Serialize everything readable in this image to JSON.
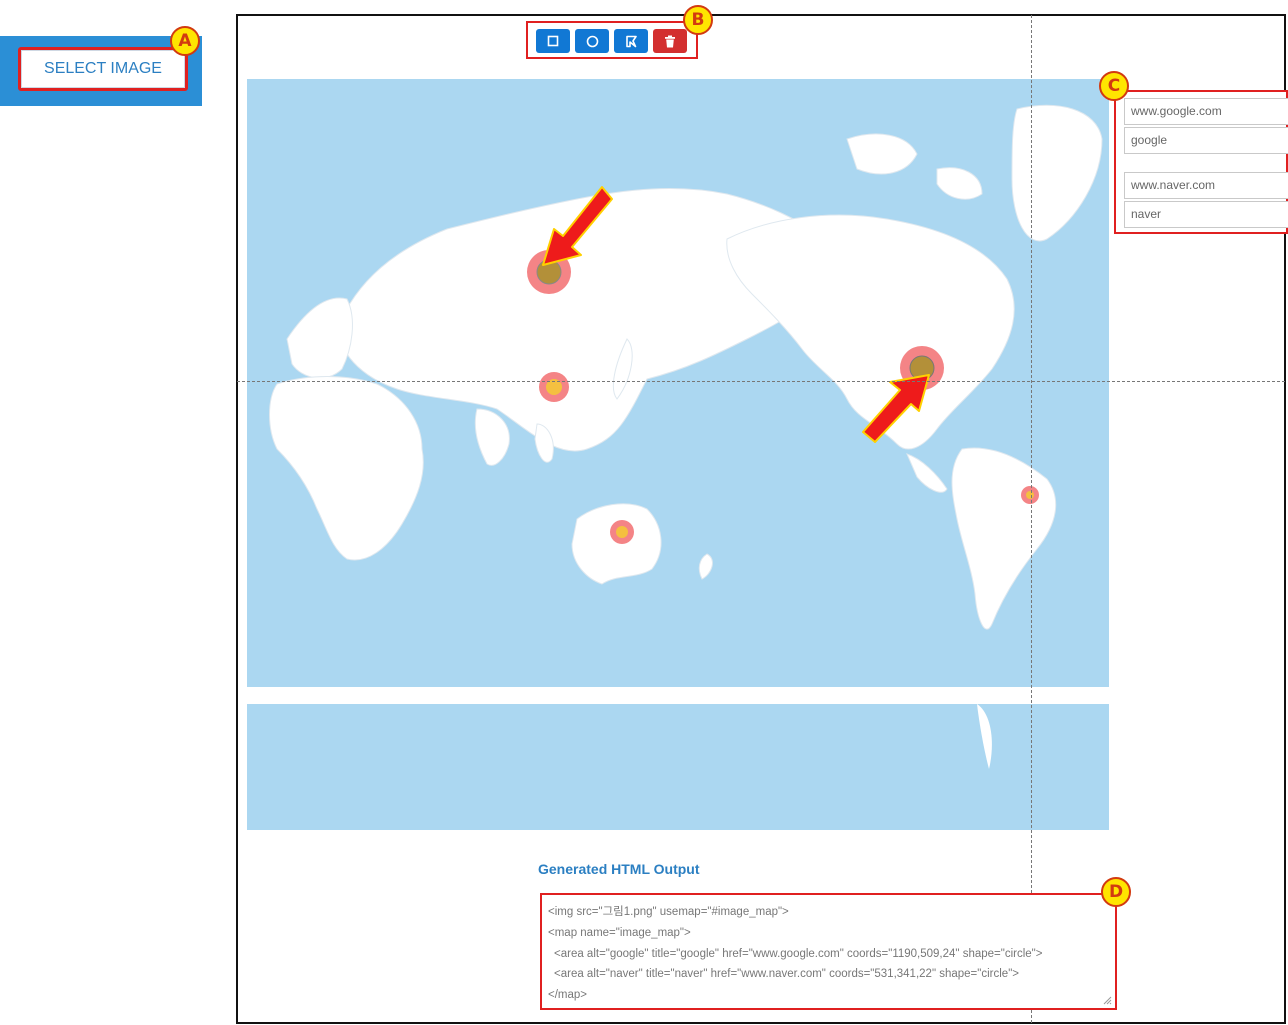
{
  "sidebar": {
    "select_image_label": "SELECT IMAGE"
  },
  "badges": {
    "a": "A",
    "b": "B",
    "c": "C",
    "d": "D"
  },
  "toolbar": {
    "tools": [
      {
        "name": "rectangle",
        "icon": "square-icon"
      },
      {
        "name": "circle",
        "icon": "circle-icon"
      },
      {
        "name": "polygon",
        "icon": "polygon-icon"
      },
      {
        "name": "delete",
        "icon": "trash-icon"
      }
    ]
  },
  "areas": [
    {
      "url": "www.google.com",
      "title": "google"
    },
    {
      "url": "www.naver.com",
      "title": "naver"
    }
  ],
  "output": {
    "title": "Generated HTML Output",
    "lines": [
      "<img src=\"그림1.png\" usemap=\"#image_map\">",
      "<map name=\"image_map\">",
      "<area alt=\"google\" title=\"google\" href=\"www.google.com\" coords=\"1190,509,24\" shape=\"circle\">",
      "<area alt=\"naver\" title=\"naver\" href=\"www.naver.com\" coords=\"531,341,22\" shape=\"circle\">",
      "</map>"
    ]
  },
  "colors": {
    "accent": "#2b8fd6",
    "tool_blue": "#1178d4",
    "delete_red": "#d32f2f",
    "highlight_red": "#e02020",
    "badge_yellow": "#ffe500",
    "ocean": "#abd7f1",
    "land": "#ffffff"
  }
}
